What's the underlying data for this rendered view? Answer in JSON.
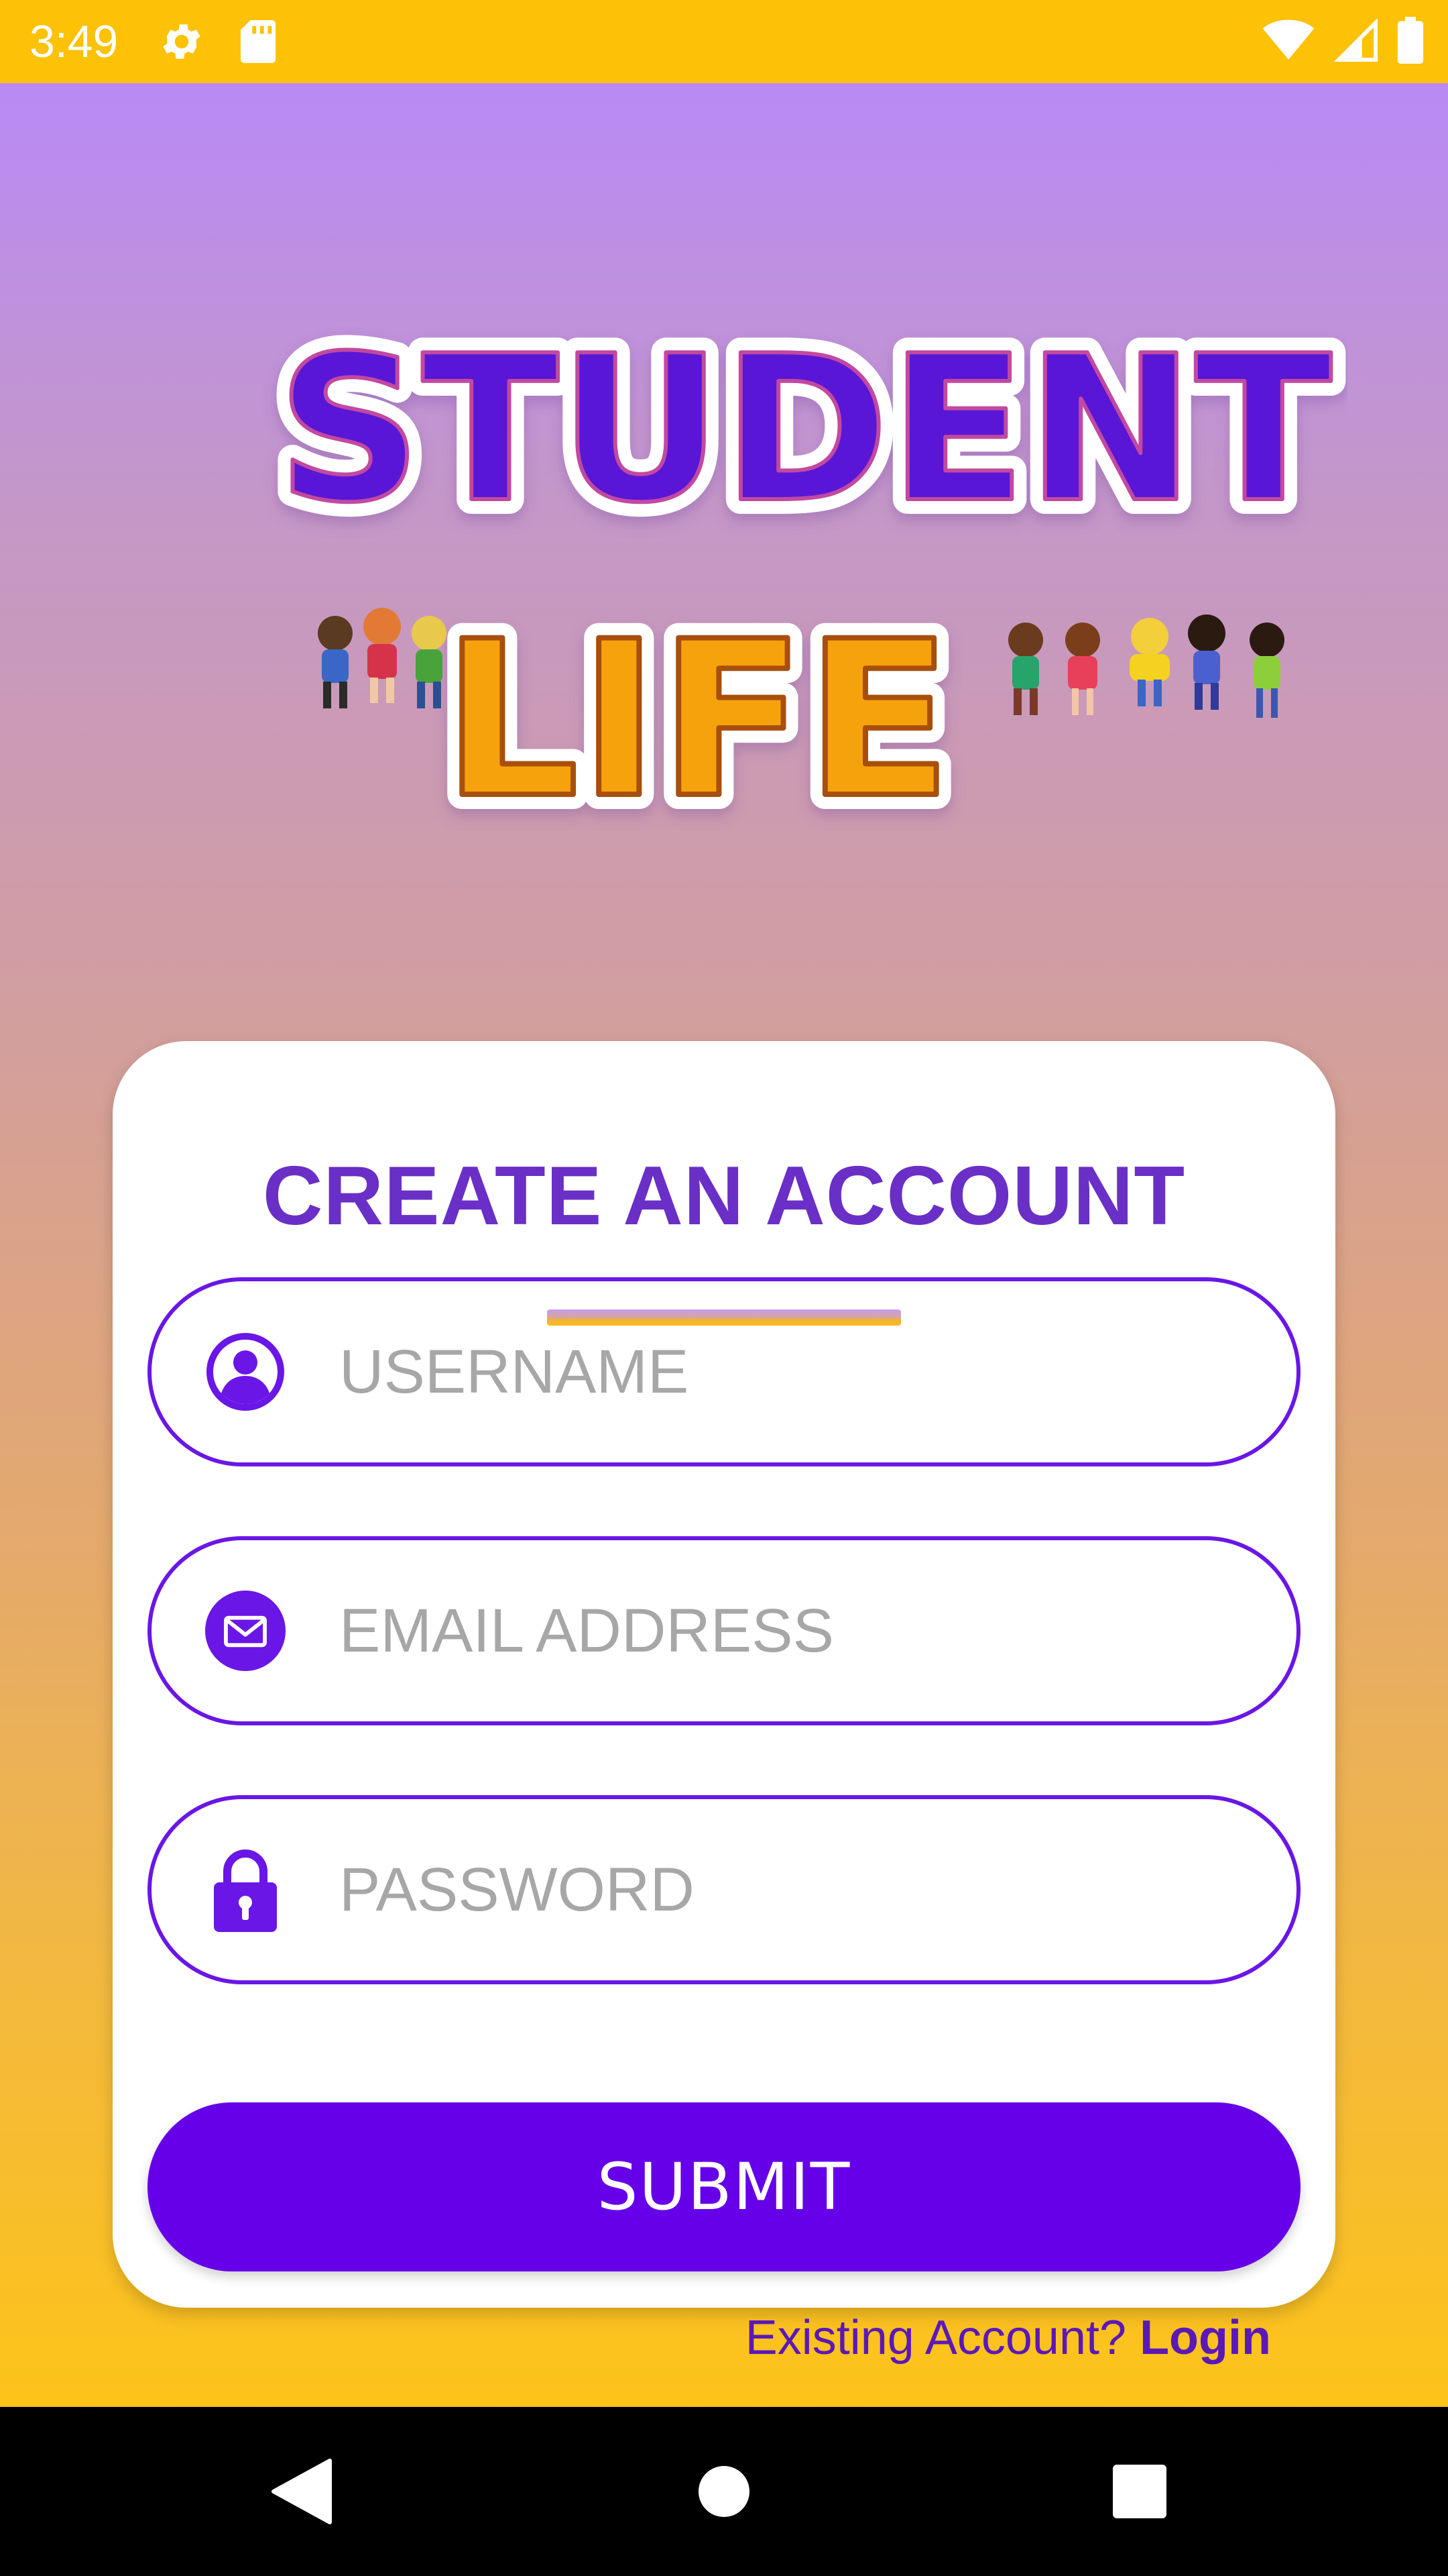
{
  "status_bar": {
    "time": "3:49",
    "icons_left": [
      "gear-icon",
      "sd-card-icon"
    ],
    "icons_right": [
      "wifi-icon",
      "signal-icon",
      "battery-icon"
    ],
    "background": "#fdc106"
  },
  "logo": {
    "line1": "STUDENT",
    "line2": "LIFE"
  },
  "form": {
    "title": "CREATE AN ACCOUNT",
    "username_placeholder": "USERNAME",
    "email_placeholder": "EMAIL ADDRESS",
    "password_placeholder": "PASSWORD",
    "submit_label": "SUBMIT",
    "existing_text": "Existing Account?",
    "login_label": "Login"
  },
  "colors": {
    "accent": "#6600e8",
    "title": "#6a2fc6",
    "field_border": "#6a16e6",
    "logo_purple": "#5a15d6",
    "logo_orange": "#f6a20a"
  },
  "nav_bar": {
    "buttons": [
      "back-icon",
      "home-icon",
      "recents-icon"
    ]
  }
}
